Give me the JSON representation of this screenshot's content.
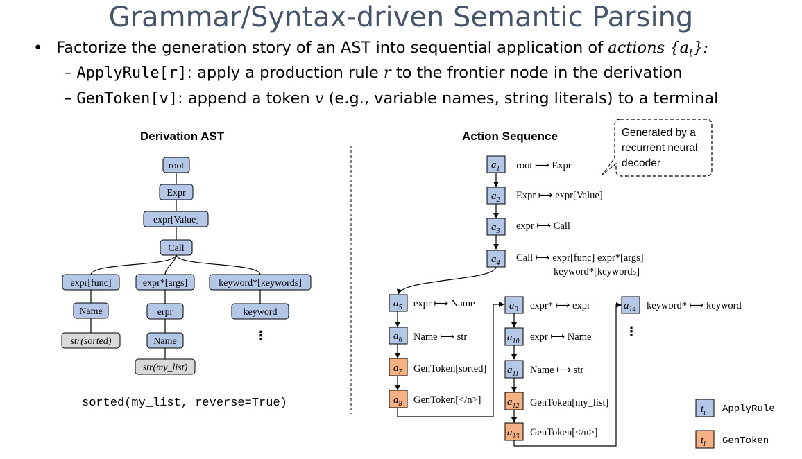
{
  "title": "Grammar/Syntax-driven Semantic Parsing",
  "bullet": {
    "marker": "•",
    "text_pre": "Factorize the generation story of an AST into sequential application of ",
    "text_em": "actions",
    "text_math": "{a",
    "text_sub": "t",
    "text_math_end": "}",
    "text_post": ":"
  },
  "sub_bullets": [
    {
      "dash": "–",
      "code": "ApplyRule[r]",
      "text_pre": ": apply a production rule ",
      "var": "r",
      "text_post": " to the frontier node in the derivation"
    },
    {
      "dash": "–",
      "code": "GenToken[v]",
      "text_pre": ": append a token ",
      "var": "v",
      "text_post": " (e.g., variable names, string literals) to a terminal"
    }
  ],
  "ast": {
    "heading": "Derivation AST",
    "nodes": {
      "root": "root",
      "expr": "Expr",
      "value": "expr[Value]",
      "call": "Call",
      "func": "expr[func]",
      "args": "expr*[args]",
      "keywords": "keyword*[keywords]",
      "name1": "Name",
      "erpr": "erpr",
      "keyword": "keyword",
      "str_sorted": "str(sorted)",
      "name2": "Name",
      "str_mylist": "str(my_list)",
      "ellipsis": "⋮"
    },
    "code": "sorted(my_list, reverse=True)"
  },
  "actions": {
    "heading": "Action Sequence",
    "callout": [
      "Generated by a",
      "recurrent neural",
      "decoder"
    ],
    "steps": [
      {
        "id": "a",
        "sub": "1",
        "kind": "ApplyRule",
        "rule": "root ⟼ Expr"
      },
      {
        "id": "a",
        "sub": "2",
        "kind": "ApplyRule",
        "rule": "Expr ⟼ expr[Value]"
      },
      {
        "id": "a",
        "sub": "3",
        "kind": "ApplyRule",
        "rule": "expr ⟼ Call"
      },
      {
        "id": "a",
        "sub": "4",
        "kind": "ApplyRule",
        "rule": "Call ⟼ expr[func] expr*[args]",
        "rule2": "keyword*[keywords]"
      },
      {
        "id": "a",
        "sub": "5",
        "kind": "ApplyRule",
        "rule": "expr ⟼ Name"
      },
      {
        "id": "a",
        "sub": "6",
        "kind": "ApplyRule",
        "rule": "Name ⟼ str"
      },
      {
        "id": "a",
        "sub": "7",
        "kind": "GenToken",
        "rule": "GenToken[sorted]"
      },
      {
        "id": "a",
        "sub": "8",
        "kind": "GenToken",
        "rule": "GenToken[</n>]"
      },
      {
        "id": "a",
        "sub": "9",
        "kind": "ApplyRule",
        "rule": "expr* ⟼ expr"
      },
      {
        "id": "a",
        "sub": "10",
        "kind": "ApplyRule",
        "rule": "expr ⟼ Name"
      },
      {
        "id": "a",
        "sub": "11",
        "kind": "ApplyRule",
        "rule": "Name ⟼ str"
      },
      {
        "id": "a",
        "sub": "12",
        "kind": "GenToken",
        "rule": "GenToken[my_list]"
      },
      {
        "id": "a",
        "sub": "13",
        "kind": "GenToken",
        "rule": "GenToken[</n>]"
      },
      {
        "id": "a",
        "sub": "14",
        "kind": "ApplyRule",
        "rule": "keyword* ⟼ keyword"
      }
    ],
    "ellipsis": "⋮"
  },
  "legend": {
    "t": "t",
    "i": "i",
    "apply_label": "ApplyRule",
    "gen_label": "GenToken"
  },
  "colors": {
    "title": "#44546a",
    "apply_rule": "#b4c7e7",
    "gen_token": "#f4b183",
    "terminal": "#d9d9d9"
  }
}
